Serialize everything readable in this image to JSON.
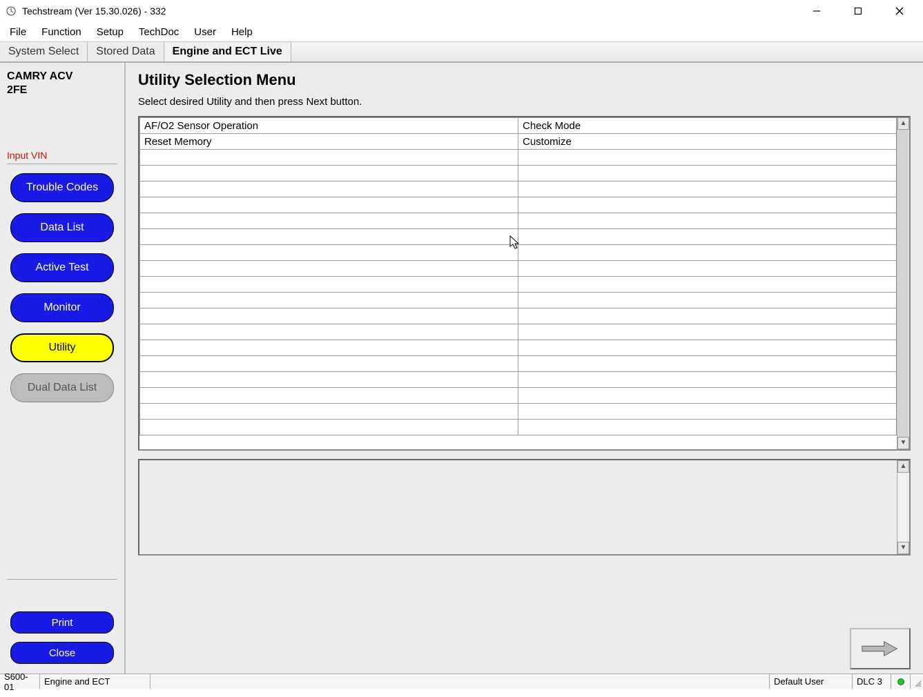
{
  "window": {
    "title": "Techstream (Ver 15.30.026) - 332"
  },
  "menu": [
    "File",
    "Function",
    "Setup",
    "TechDoc",
    "User",
    "Help"
  ],
  "tabs": [
    {
      "label": "System Select",
      "active": false
    },
    {
      "label": "Stored Data",
      "active": false
    },
    {
      "label": "Engine and ECT Live",
      "active": true
    }
  ],
  "sidebar": {
    "vehicle_line1": "CAMRY ACV",
    "vehicle_line2": "2FE",
    "input_vin": "Input VIN",
    "buttons": [
      {
        "label": "Trouble Codes",
        "style": "blue"
      },
      {
        "label": "Data List",
        "style": "blue"
      },
      {
        "label": "Active Test",
        "style": "blue"
      },
      {
        "label": "Monitor",
        "style": "blue"
      },
      {
        "label": "Utility",
        "style": "yellow"
      },
      {
        "label": "Dual Data List",
        "style": "grey"
      }
    ],
    "print": "Print",
    "close": "Close"
  },
  "main": {
    "title": "Utility Selection Menu",
    "subtitle": "Select desired Utility and then press Next button.",
    "rows": [
      {
        "left": "AF/O2 Sensor Operation",
        "right": "Check Mode"
      },
      {
        "left": "Reset Memory",
        "right": "Customize"
      },
      {
        "left": "",
        "right": ""
      },
      {
        "left": "",
        "right": ""
      },
      {
        "left": "",
        "right": ""
      },
      {
        "left": "",
        "right": ""
      },
      {
        "left": "",
        "right": ""
      },
      {
        "left": "",
        "right": ""
      },
      {
        "left": "",
        "right": ""
      },
      {
        "left": "",
        "right": ""
      },
      {
        "left": "",
        "right": ""
      },
      {
        "left": "",
        "right": ""
      },
      {
        "left": "",
        "right": ""
      },
      {
        "left": "",
        "right": ""
      },
      {
        "left": "",
        "right": ""
      },
      {
        "left": "",
        "right": ""
      },
      {
        "left": "",
        "right": ""
      },
      {
        "left": "",
        "right": ""
      },
      {
        "left": "",
        "right": ""
      },
      {
        "left": "",
        "right": ""
      }
    ]
  },
  "status": {
    "code": "S600-01",
    "system": "Engine and ECT",
    "user": "Default User",
    "dlc": "DLC 3"
  }
}
